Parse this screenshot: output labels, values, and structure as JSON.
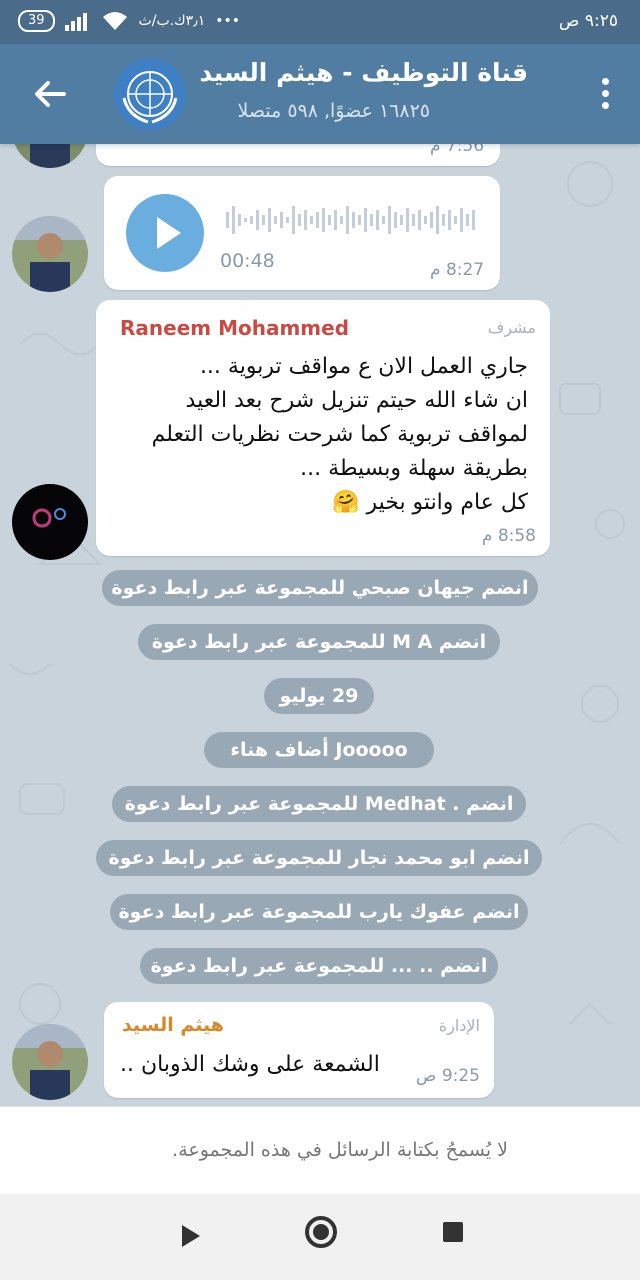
{
  "status_bar": {
    "time": "٩:٢٥ ص",
    "battery": "39",
    "net_speed": "٣٫١ك.ب/ث"
  },
  "header": {
    "title": "قناة التوظيف - هيثم السيد",
    "subtitle": "١٦٨٢٥ عضوًا, ٥٩٨ متصلا"
  },
  "messages": {
    "partial_time": "7:56 م",
    "voice": {
      "duration": "00:48",
      "time": "8:27 م"
    },
    "raneem": {
      "sender": "Raneem Mohammed",
      "role": "مشرف",
      "lines": [
        "جاري العمل الان ع مواقف تربوية ...",
        "ان شاء الله حيتم تنزيل شرح بعد العيد",
        "لمواقف تربوية كما شرحت نظريات التعلم",
        "بطريقة سهلة وبسيطة ...",
        "كل عام وانتو بخير 🤗"
      ],
      "time": "8:58 م"
    },
    "service": [
      "انضم جيهان صبحي للمجموعة عبر رابط دعوة",
      "انضم M A للمجموعة عبر رابط دعوة",
      "29 يوليو",
      "Jooooo أضاف هناء",
      "انضم . Medhat للمجموعة عبر رابط دعوة",
      "انضم ابو محمد نجار للمجموعة عبر رابط دعوة",
      "انضم عفوك يارب للمجموعة عبر رابط دعوة",
      "انضم .. ... للمجموعة عبر رابط دعوة"
    ],
    "haitham": {
      "sender": "هيثم السيد",
      "role": "الإدارة",
      "text": "الشمعة على وشك الذوبان ..",
      "time": "9:25 ص"
    }
  },
  "footer": {
    "note": "لا يُسمحُ بكتابة الرسائل في هذه المجموعة."
  },
  "colors": {
    "header": "#517da2",
    "raneem_name": "#c84b43",
    "haitham_name": "#d58a2a",
    "play_button": "#6aaee0"
  }
}
